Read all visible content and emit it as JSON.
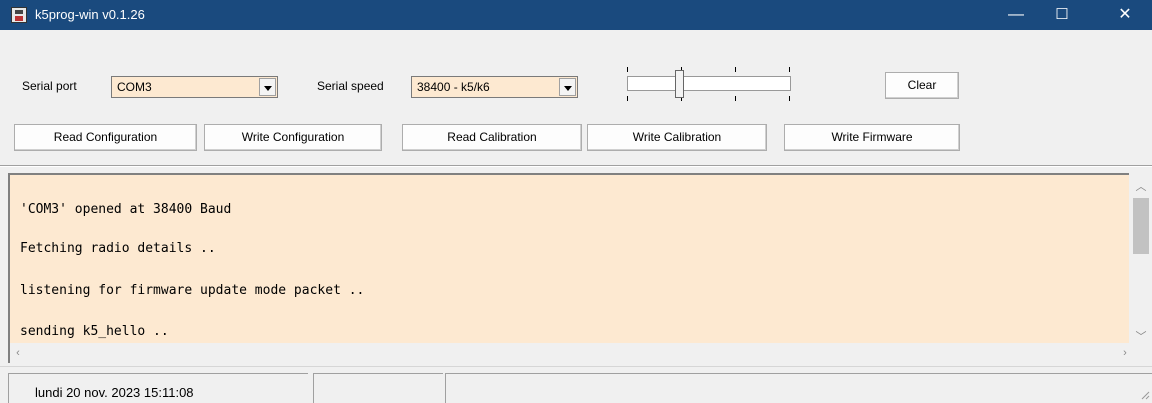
{
  "window": {
    "title": "k5prog-win v0.1.26",
    "minimize_glyph": "—",
    "maximize_glyph": "☐",
    "close_glyph": "✕"
  },
  "controls": {
    "serial_port_label": "Serial port",
    "serial_port_value": "COM3",
    "serial_speed_label": "Serial speed",
    "serial_speed_value": "38400 - k5/k6",
    "clear_label": "Clear"
  },
  "buttons": {
    "read_configuration": "Read Configuration",
    "write_configuration": "Write Configuration",
    "read_calibration": "Read Calibration",
    "write_calibration": "Write Calibration",
    "write_firmware": "Write Firmware"
  },
  "log": {
    "lines": [
      "'COM3' opened at 38400 Baud",
      "Fetching radio details ..",
      "listening for firmware update mode packet ..",
      "sending k5_hello .."
    ]
  },
  "status": {
    "datetime": "lundi 20 nov. 2023  15:11:08"
  },
  "colors": {
    "titlebar": "#1a4a7e",
    "field_background": "#fde9d1",
    "log_background": "#fde9d1"
  }
}
